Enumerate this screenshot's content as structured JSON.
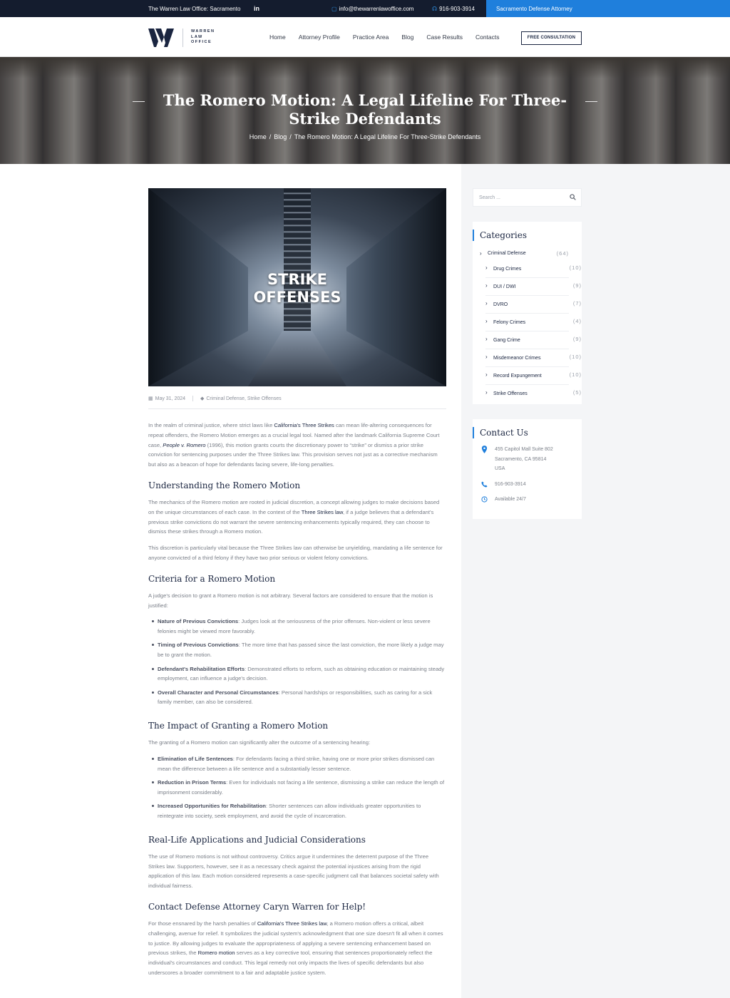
{
  "topbar": {
    "office": "The Warren Law Office: Sacramento",
    "social": "in",
    "email": "info@thewarrenlawoffice.com",
    "phone": "916-903-3914",
    "cta": "Sacramento Defense Attorney"
  },
  "header": {
    "logo_lines": [
      "WARREN",
      "LAW",
      "OFFICE"
    ],
    "nav": [
      "Home",
      "Attorney Profile",
      "Practice Area",
      "Blog",
      "Case Results",
      "Contacts"
    ],
    "consult_button": "FREE CONSULTATION"
  },
  "hero": {
    "title": "The Romero Motion: A Legal Lifeline For Three-Strike Defendants",
    "breadcrumb": [
      "Home",
      "Blog",
      "The Romero Motion: A Legal Lifeline For Three-Strike Defendants"
    ],
    "separator": "/"
  },
  "article": {
    "image_text": [
      "STRIKE",
      "OFFENSES"
    ],
    "date": "May 31, 2024",
    "categories": "Criminal Defense, Strike Offenses",
    "intro": {
      "t1": "In the realm of criminal justice, where strict laws like ",
      "l1": "California's Three Strikes",
      "t2": " can mean life-altering consequences for repeat offenders, the Romero Motion emerges as a crucial legal tool. Named after the landmark California Supreme Court case, ",
      "l2": "People v. Romero",
      "t3": " (1996), this motion grants courts the discretionary power to “strike” or dismiss a prior strike conviction for sentencing purposes under the Three Strikes law. This provision serves not just as a corrective mechanism but also as a beacon of hope for defendants facing severe, life-long penalties."
    },
    "s1": {
      "heading": "Understanding the Romero Motion",
      "p1a": "The mechanics of the Romero motion are rooted in judicial discretion, a concept allowing judges to make decisions based on the unique circumstances of each case. In the context of the ",
      "p1link": "Three Strikes law",
      "p1b": ", if a judge believes that a defendant's previous strike convictions do not warrant the severe sentencing enhancements typically required, they can choose to dismiss these strikes through a Romero motion.",
      "p2": "This discretion is particularly vital because the Three Strikes law can otherwise be unyielding, mandating a life sentence for anyone convicted of a third felony if they have two prior serious or violent felony convictions."
    },
    "s2": {
      "heading": "Criteria for a Romero Motion",
      "intro": "A judge's decision to grant a Romero motion is not arbitrary. Several factors are considered to ensure that the motion is justified:",
      "items": [
        {
          "b": "Nature of Previous Convictions",
          "t": ": Judges look at the seriousness of the prior offenses. Non-violent or less severe felonies might be viewed more favorably."
        },
        {
          "b": "Timing of Previous Convictions",
          "t": ": The more time that has passed since the last conviction, the more likely a judge may be to grant the motion."
        },
        {
          "b": "Defendant's Rehabilitation Efforts",
          "t": ": Demonstrated efforts to reform, such as obtaining education or maintaining steady employment, can influence a judge's decision."
        },
        {
          "b": "Overall Character and Personal Circumstances",
          "t": ": Personal hardships or responsibilities, such as caring for a sick family member, can also be considered."
        }
      ]
    },
    "s3": {
      "heading": "The Impact of Granting a Romero Motion",
      "intro": "The granting of a Romero motion can significantly alter the outcome of a sentencing hearing:",
      "items": [
        {
          "b": "Elimination of Life Sentences",
          "t": ": For defendants facing a third strike, having one or more prior strikes dismissed can mean the difference between a life sentence and a substantially lesser sentence."
        },
        {
          "b": "Reduction in Prison Terms",
          "t": ": Even for individuals not facing a life sentence, dismissing a strike can reduce the length of imprisonment considerably."
        },
        {
          "b": "Increased Opportunities for Rehabilitation",
          "t": ": Shorter sentences can allow individuals greater opportunities to reintegrate into society, seek employment, and avoid the cycle of incarceration."
        }
      ]
    },
    "s4": {
      "heading": "Real-Life Applications and Judicial Considerations",
      "p": "The use of Romero motions is not without controversy. Critics argue it undermines the deterrent purpose of the Three Strikes law. Supporters, however, see it as a necessary check against the potential injustices arising from the rigid application of this law. Each motion considered represents a case-specific judgment call that balances societal safety with individual fairness."
    },
    "s5": {
      "heading": "Contact Defense Attorney Caryn Warren for Help!",
      "t1": "For those ensnared by the harsh penalties of ",
      "l1": "California's Three Strikes law",
      "t2": ", a Romero motion offers a critical, albeit challenging, avenue for relief. It symbolizes the judicial system's acknowledgment that one size doesn't fit all when it comes to justice. By allowing judges to evaluate the appropriateness of applying a severe sentencing enhancement based on previous strikes, the ",
      "l2": "Romero motion",
      "t3": " serves as a key corrective tool, ensuring that sentences proportionately reflect the individual's circumstances and conduct. This legal remedy not only impacts the lives of specific defendants but also underscores a broader commitment to a fair and adaptable justice system."
    }
  },
  "sidebar": {
    "search_placeholder": "Search ...",
    "categories_title": "Categories",
    "categories": [
      {
        "name": "Criminal Defense",
        "count": "(64)"
      },
      {
        "name": "Drug Crimes",
        "count": "(10)"
      },
      {
        "name": "DUI / DWI",
        "count": "(9)"
      },
      {
        "name": "DVRO",
        "count": "(7)"
      },
      {
        "name": "Felony Crimes",
        "count": "(4)"
      },
      {
        "name": "Gang Crime",
        "count": "(9)"
      },
      {
        "name": "Misdemeanor Crimes",
        "count": "(10)"
      },
      {
        "name": "Record Expungement",
        "count": "(10)"
      },
      {
        "name": "Strike Offenses",
        "count": "(5)"
      }
    ],
    "contact_title": "Contact Us",
    "address": [
      "455 Capitol Mall Suite 802",
      "Sacramento, CA 95814",
      "USA"
    ],
    "phone": "916-903-3914",
    "hours": "Available 24/7",
    "accent_color": "#1f7fdc",
    "dark_color": "#141c2e"
  }
}
